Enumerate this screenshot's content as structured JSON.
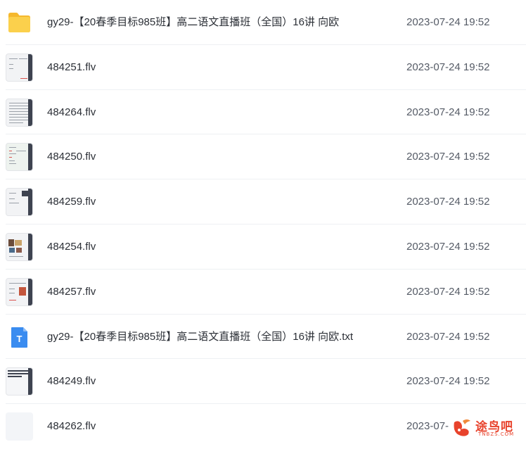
{
  "files": [
    {
      "name": "gy29-【20春季目标985班】高二语文直播班（全国）16讲 向欧",
      "date": "2023-07-24 19:52",
      "icon": "folder-icon"
    },
    {
      "name": "484251.flv",
      "date": "2023-07-24 19:52",
      "icon": "video-thumbnail"
    },
    {
      "name": "484264.flv",
      "date": "2023-07-24 19:52",
      "icon": "video-thumbnail"
    },
    {
      "name": "484250.flv",
      "date": "2023-07-24 19:52",
      "icon": "video-thumbnail"
    },
    {
      "name": "484259.flv",
      "date": "2023-07-24 19:52",
      "icon": "video-thumbnail"
    },
    {
      "name": "484254.flv",
      "date": "2023-07-24 19:52",
      "icon": "video-thumbnail"
    },
    {
      "name": "484257.flv",
      "date": "2023-07-24 19:52",
      "icon": "video-thumbnail"
    },
    {
      "name": "gy29-【20春季目标985班】高二语文直播班（全国）16讲 向欧.txt",
      "date": "2023-07-24 19:52",
      "icon": "text-file-icon"
    },
    {
      "name": "484249.flv",
      "date": "2023-07-24 19:52",
      "icon": "video-thumbnail"
    },
    {
      "name": "484262.flv",
      "date": "2023-07-",
      "icon": "video-thumbnail"
    }
  ],
  "watermark": {
    "text": "途鸟吧",
    "sub": "TNBZS.COM"
  },
  "colors": {
    "folder": "#f7c236",
    "text_icon": "#3a8cf0",
    "watermark": "#e8432c"
  }
}
